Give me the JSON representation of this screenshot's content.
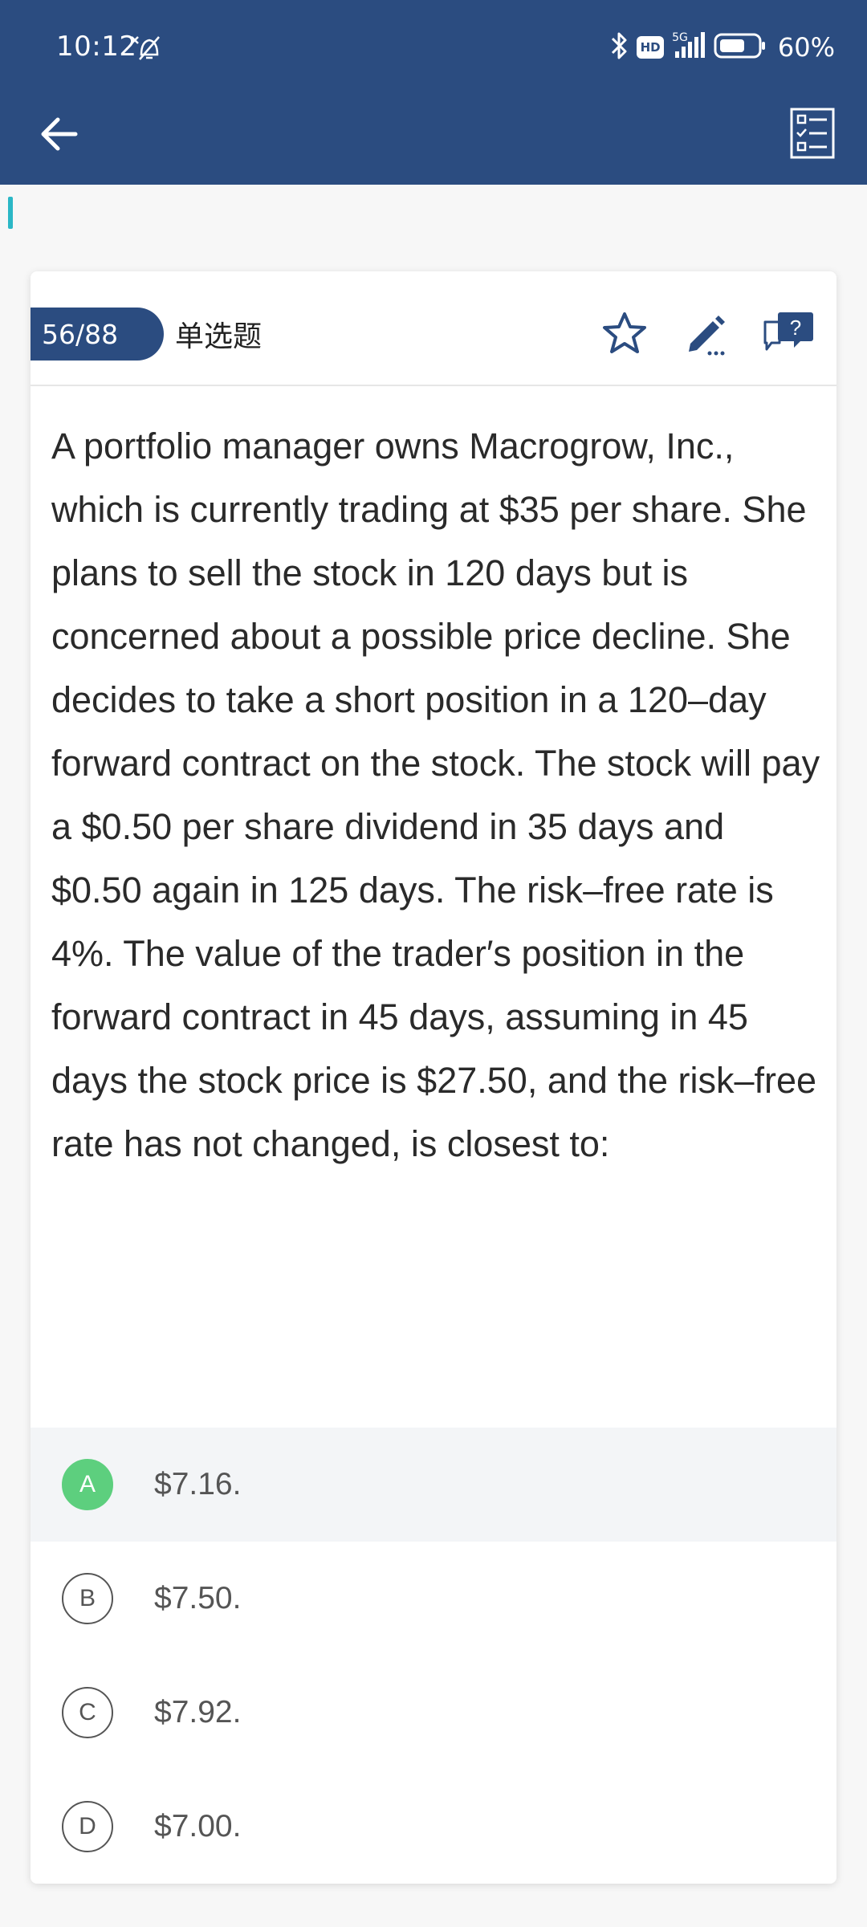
{
  "status_bar": {
    "time": "10:12",
    "network": "5G",
    "hd": "HD",
    "battery": "60%"
  },
  "question_card": {
    "counter": "56/88",
    "type": "单选题",
    "question": "A portfolio manager owns Macrogrow, Inc., which is currently trading at $35 per share. She plans to sell the stock in 120 days but is concerned about a possible price decline. She decides to take a short position in a 120–day forward contract on the stock. The stock will pay a $0.50 per share dividend in 35 days and $0.50 again in 125 days. The risk–free rate is 4%. The value of the trader′s position in the forward contract in 45 days, assuming in 45 days the stock price is $27.50, and the risk–free rate has not changed, is closest to:",
    "options": [
      {
        "letter": "A",
        "text": "$7.16.",
        "selected": true
      },
      {
        "letter": "B",
        "text": "$7.50.",
        "selected": false
      },
      {
        "letter": "C",
        "text": " $7.92.",
        "selected": false
      },
      {
        "letter": "D",
        "text": "$7.00.",
        "selected": false
      }
    ]
  },
  "colors": {
    "header": "#2b4c80",
    "accent": "#2bb7c6",
    "selected": "#5dcf7e"
  }
}
